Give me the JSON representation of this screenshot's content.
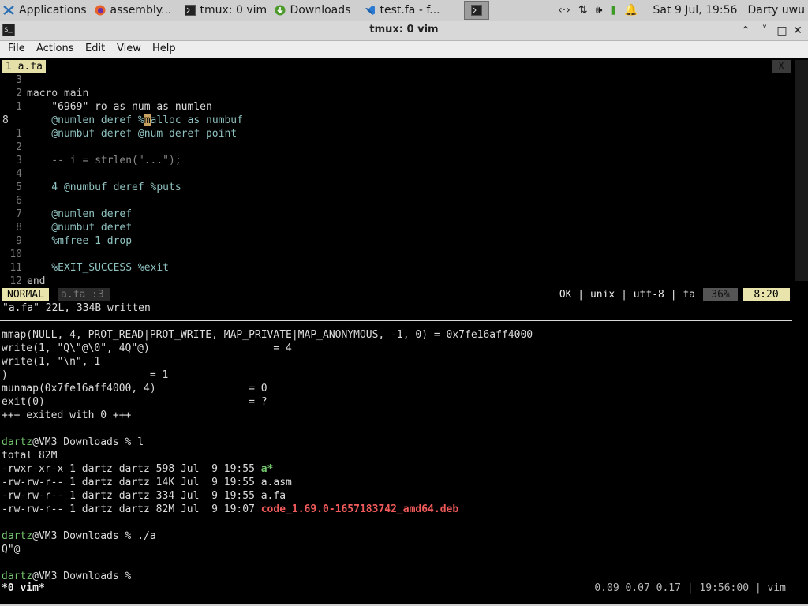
{
  "panel": {
    "tasks": [
      {
        "label": "Applications",
        "icon": "xfce-mouse-icon"
      },
      {
        "label": "assembly...",
        "icon": "firefox-icon"
      },
      {
        "label": "tmux: 0 vim",
        "icon": "terminal-icon"
      },
      {
        "label": "Downloads",
        "icon": "download-icon"
      },
      {
        "label": "test.fa - f...",
        "icon": "vscode-icon"
      },
      {
        "label": "",
        "icon": "terminal-icon"
      }
    ],
    "tray": {
      "network": "‹·›",
      "updown": "⇅",
      "volume": "🕪",
      "battery": "▮",
      "bell": "🔔",
      "datetime": "Sat  9 Jul, 19:56",
      "user": "Darty uwu"
    }
  },
  "window": {
    "title": "tmux: 0 vim",
    "minimize": "⌃",
    "restore": "˅",
    "maximize": "□",
    "close": "✕"
  },
  "menu": [
    "File",
    "Actions",
    "Edit",
    "View",
    "Help"
  ],
  "vim": {
    "tab": "1 a.fa",
    "close": "X",
    "lines": [
      {
        "num": "3",
        "text": ""
      },
      {
        "num": "2",
        "text": "macro main"
      },
      {
        "num": "1",
        "text": "    \"6969\" ro as num as numlen"
      },
      {
        "num": "8",
        "text": "    @numlen deref %malloc as numbuf"
      },
      {
        "num": "1",
        "text": "    @numbuf deref @num deref point"
      },
      {
        "num": "2",
        "text": ""
      },
      {
        "num": "3",
        "text": "    -- i = strlen(\"...\");"
      },
      {
        "num": "4",
        "text": ""
      },
      {
        "num": "5",
        "text": "    4 @numbuf deref %puts"
      },
      {
        "num": "6",
        "text": ""
      },
      {
        "num": "7",
        "text": "    @numlen deref"
      },
      {
        "num": "8",
        "text": "    @numbuf deref"
      },
      {
        "num": "9",
        "text": "    %mfree 1 drop"
      },
      {
        "num": "10",
        "text": ""
      },
      {
        "num": "11",
        "text": "    %EXIT_SUCCESS %exit"
      },
      {
        "num": "12",
        "text": "end"
      }
    ],
    "status": {
      "mode": "NORMAL",
      "file": "a.fa",
      "line_indicator": ":3",
      "info": "OK | unix | utf-8 | fa",
      "percent": "36%",
      "position": "8:20"
    },
    "message": "\"a.fa\" 22L, 334B written"
  },
  "shell": {
    "lines": [
      "mmap(NULL, 4, PROT_READ|PROT_WRITE, MAP_PRIVATE|MAP_ANONYMOUS, -1, 0) = 0x7fe16aff4000",
      "write(1, \"Q\\\"@\\0\", 4Q\"@)                    = 4",
      "write(1, \"\\n\", 1",
      ")                       = 1",
      "munmap(0x7fe16aff4000, 4)               = 0",
      "exit(0)                                 = ?",
      "+++ exited with 0 +++",
      ""
    ],
    "prompt_user": "dartz",
    "prompt_rest": "@VM3 Downloads % ",
    "cmd1": "l",
    "total": "total 82M",
    "files": [
      {
        "meta": "-rwxr-xr-x 1 dartz dartz 598 Jul  9 19:55 ",
        "name": "a*",
        "kind": "exec"
      },
      {
        "meta": "-rw-rw-r-- 1 dartz dartz 14K Jul  9 19:55 ",
        "name": "a.asm",
        "kind": "plain"
      },
      {
        "meta": "-rw-rw-r-- 1 dartz dartz 334 Jul  9 19:55 ",
        "name": "a.fa",
        "kind": "plain"
      },
      {
        "meta": "-rw-rw-r-- 1 dartz dartz 82M Jul  9 19:07 ",
        "name": "code_1.69.0-1657183742_amd64.deb",
        "kind": "archive"
      }
    ],
    "cmd2": "./a",
    "output2": "Q\"@",
    "cmd3": ""
  },
  "tmux": {
    "window": " *0 vim*",
    "right": "0.09 0.07 0.17 | 19:56:00 | vim"
  }
}
